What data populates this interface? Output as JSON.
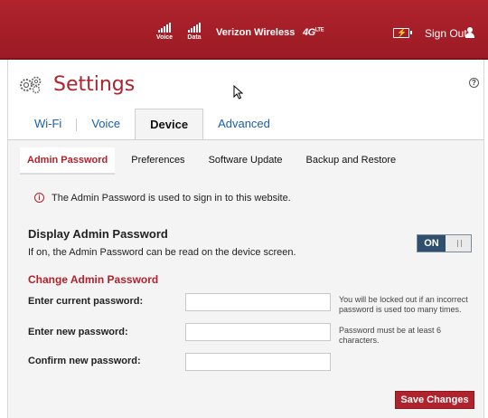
{
  "header": {
    "voice_label": "Voice",
    "data_label": "Data",
    "carrier": "Verizon Wireless",
    "network": "4G",
    "network_suffix": "LTE",
    "sign_out": "Sign Out"
  },
  "page": {
    "title": "Settings",
    "help": "?"
  },
  "tabs": [
    {
      "label": "Wi-Fi"
    },
    {
      "label": "Voice"
    },
    {
      "label": "Device"
    },
    {
      "label": "Advanced"
    }
  ],
  "subtabs": [
    {
      "label": "Admin Password"
    },
    {
      "label": "Preferences"
    },
    {
      "label": "Software Update"
    },
    {
      "label": "Backup and Restore"
    }
  ],
  "info": {
    "icon": "i",
    "text": "The Admin Password is used to sign in to this website."
  },
  "display_password": {
    "title": "Display Admin Password",
    "description": "If on, the Admin Password can be read on the device screen.",
    "toggle_label": "ON"
  },
  "change_password": {
    "title": "Change Admin Password",
    "fields": [
      {
        "label": "Enter current password:",
        "value": "",
        "hint": "You will be locked out if an incorrect password is used too many times."
      },
      {
        "label": "Enter new password:",
        "value": "",
        "hint": "Password must be at least 6 characters."
      },
      {
        "label": "Confirm new password:",
        "value": "",
        "hint": ""
      }
    ],
    "save_label": "Save Changes"
  },
  "colors": {
    "brand": "#b0232d",
    "link": "#1a5fa8",
    "toggle_on": "#2e4f6e"
  }
}
